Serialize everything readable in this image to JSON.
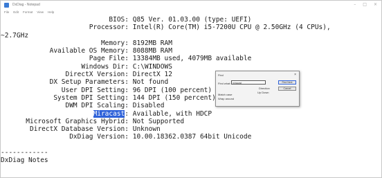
{
  "window": {
    "title": "DxDiag - Notepad",
    "controls": [
      "–",
      "□",
      "×"
    ]
  },
  "menu": [
    "File",
    "Edit",
    "Format",
    "View",
    "Help"
  ],
  "lines": [
    {
      "key": "BIOS:",
      "value": "Q85 Ver. 01.03.00 (type: UEFI)"
    },
    {
      "key": "Processor:",
      "value": "Intel(R) Core(TM) i5-7200U CPU @ 2.50GHz (4 CPUs),"
    },
    {
      "key": "",
      "value": "~2.7GHz",
      "raw": true
    },
    {
      "key": "Memory:",
      "value": "8192MB RAM"
    },
    {
      "key": "Available OS Memory:",
      "value": "8088MB RAM"
    },
    {
      "key": "Page File:",
      "value": "13384MB used, 4079MB available"
    },
    {
      "key": "Windows Dir:",
      "value": "C:\\WINDOWS"
    },
    {
      "key": "DirectX Version:",
      "value": "DirectX 12"
    },
    {
      "key": "DX Setup Parameters:",
      "value": "Not found"
    },
    {
      "key": "User DPI Setting:",
      "value": "96 DPI (100 percent)"
    },
    {
      "key": "System DPI Setting:",
      "value": "144 DPI (150 percent)"
    },
    {
      "key": "DWM DPI Scaling:",
      "value": "Disabled"
    },
    {
      "key": "Miracast:",
      "value": "Available, with HDCP",
      "highlight": "Miracast"
    },
    {
      "key": "Microsoft Graphics Hybrid:",
      "value": "Not Supported"
    },
    {
      "key": "DirectX Database Version:",
      "value": "Unknown"
    },
    {
      "key": "DxDiag Version:",
      "value": "10.00.18362.0387 64bit Unicode"
    },
    {
      "key": "",
      "value": "",
      "raw": true
    },
    {
      "key": "",
      "value": "------------",
      "raw": true
    },
    {
      "key": "",
      "value": "DxDiag Notes",
      "raw": true
    }
  ],
  "find_dialog": {
    "title": "Find",
    "find_label": "Find what:",
    "find_value": "miracast",
    "find_next": "Find Next",
    "cancel": "Cancel",
    "direction_label": "Direction",
    "direction_options": "Up  Down",
    "match_case": "Match case",
    "wrap_around": "Wrap around"
  }
}
